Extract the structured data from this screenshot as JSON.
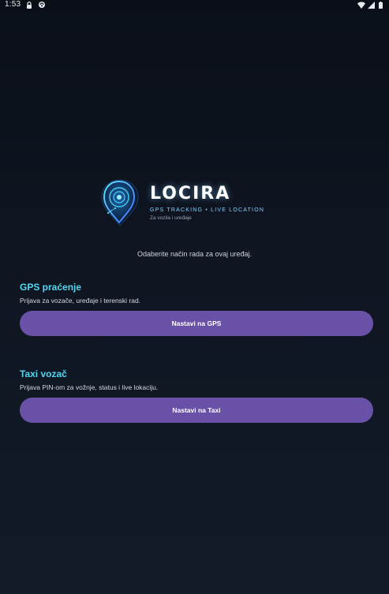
{
  "status_bar": {
    "time": "1:53",
    "icons_left": [
      "lock-icon",
      "sync-icon"
    ],
    "icons_right": [
      "wifi-icon",
      "signal-icon",
      "battery-icon"
    ]
  },
  "logo": {
    "title": "LOCIRA",
    "tagline": "GPS TRACKING • LIVE LOCATION",
    "subtagline": "Za vozila i uređaje",
    "icon": "location-pin-icon"
  },
  "intro_text": "Odaberite način rada za ovaj uređaj.",
  "modes": {
    "gps": {
      "title": "GPS praćenje",
      "description": "Prijava za vozače, uređaje i terenski rad.",
      "button_label": "Nastavi na GPS"
    },
    "taxi": {
      "title": "Taxi vozač",
      "description": "Prijava PIN-om za vožnje, status i live lokaciju.",
      "button_label": "Nastavi na Taxi"
    }
  },
  "colors": {
    "accent": "#55d6f0",
    "button": "#6a51a8",
    "background": "#0f1622"
  }
}
